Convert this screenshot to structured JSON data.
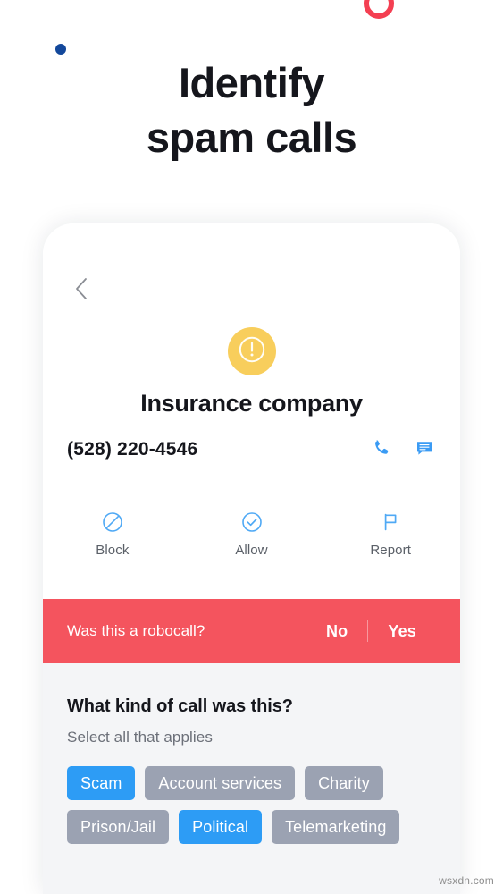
{
  "headline": {
    "line1": "Identify",
    "line2": "spam calls"
  },
  "decorations": {
    "ring_color": "#F43F52",
    "dot_color": "#13489B"
  },
  "phone_screen": {
    "back_icon": "chevron-left-icon",
    "badge": {
      "icon": "exclamation-circle-icon",
      "color": "#F8CE5C"
    },
    "caller_name": "Insurance company",
    "phone_number": "(528) 220-4546",
    "contact_actions": [
      {
        "icon": "phone-call-icon",
        "color": "#3A9BF4"
      },
      {
        "icon": "message-bubble-icon",
        "color": "#3A9BF4"
      }
    ],
    "actions": [
      {
        "label": "Block",
        "icon": "block-circle-icon"
      },
      {
        "label": "Allow",
        "icon": "check-circle-icon"
      },
      {
        "label": "Report",
        "icon": "flag-icon"
      }
    ],
    "action_icon_color": "#4FA9F5",
    "robocall": {
      "question": "Was this a robocall?",
      "no_label": "No",
      "yes_label": "Yes",
      "background": "#F4545E"
    },
    "tags": {
      "title": "What kind of call was this?",
      "subtitle": "Select all that applies",
      "selected_color": "#2D9CF5",
      "unselected_color": "#9BA2B2",
      "chips": [
        {
          "label": "Scam",
          "selected": true
        },
        {
          "label": "Account services",
          "selected": false
        },
        {
          "label": "Charity",
          "selected": false
        },
        {
          "label": "Prison/Jail",
          "selected": false
        },
        {
          "label": "Political",
          "selected": true
        },
        {
          "label": "Telemarketing",
          "selected": false
        }
      ]
    }
  },
  "watermark": "wsxdn.com"
}
